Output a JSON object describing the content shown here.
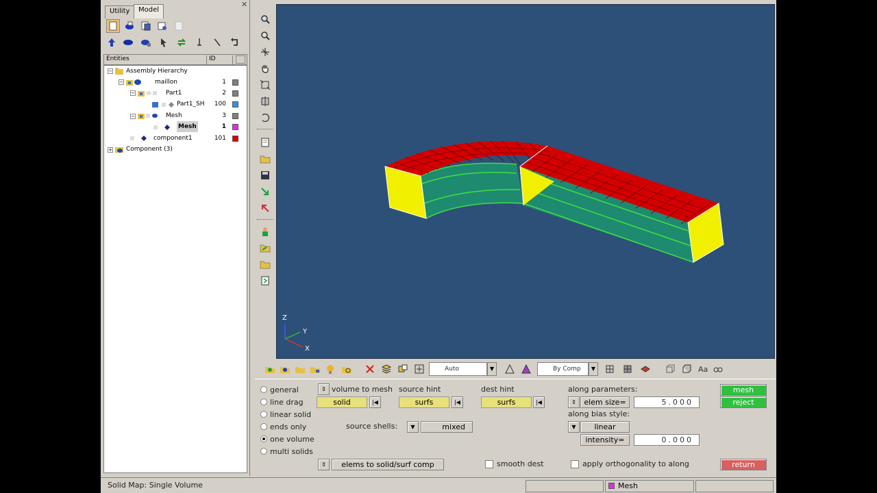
{
  "tabs": [
    {
      "label": "Utility"
    },
    {
      "label": "Model"
    }
  ],
  "entities_header": {
    "entities": "Entities",
    "id": "ID"
  },
  "tree": [
    {
      "label": "Assembly Hierarchy",
      "id": "",
      "color": ""
    },
    {
      "label": "maillon",
      "id": "1",
      "color": "#808080"
    },
    {
      "label": "Part1",
      "id": "2",
      "color": "#808080"
    },
    {
      "label": "Part1_SH",
      "id": "100",
      "color": "#3a8fe0"
    },
    {
      "label": "Mesh",
      "id": "3",
      "color": "#808080"
    },
    {
      "label": "Mesh",
      "id": "1",
      "color": "#e030e0"
    },
    {
      "label": "component1",
      "id": "101",
      "color": "#e00000"
    },
    {
      "label": "Component (3)",
      "id": "",
      "color": ""
    }
  ],
  "viewport": {
    "background": "#2d5078",
    "axis_labels": {
      "x": "X",
      "y": "Y",
      "z": "Z"
    }
  },
  "toolbar": {
    "display_mode": "Auto",
    "color_mode": "By Comp"
  },
  "panel": {
    "radios": [
      {
        "label": "general",
        "selected": false
      },
      {
        "label": "line drag",
        "selected": false
      },
      {
        "label": "linear solid",
        "selected": false
      },
      {
        "label": "ends only",
        "selected": false
      },
      {
        "label": "one volume",
        "selected": true
      },
      {
        "label": "multi solids",
        "selected": false
      }
    ],
    "volume_to_mesh": {
      "label": "volume to mesh",
      "button": "solid"
    },
    "source_hint": {
      "label": "source hint",
      "button": "surfs"
    },
    "dest_hint": {
      "label": "dest hint",
      "button": "surfs"
    },
    "source_shells": {
      "label": "source shells:",
      "value": "mixed"
    },
    "along_parameters": {
      "label": "along parameters:",
      "selector": "elem size=",
      "value": "5.000"
    },
    "along_bias_style": {
      "label": "along bias style:",
      "value": "linear"
    },
    "intensity": {
      "label": "intensity=",
      "value": "0.000"
    },
    "elems_to_comp": "elems to solid/surf comp",
    "smooth_dest": {
      "label": "smooth dest",
      "checked": false
    },
    "apply_orthogonality": {
      "label": "apply orthogonality to along",
      "checked": false
    },
    "mesh_button": "mesh",
    "reject_button": "reject",
    "return_button": "return"
  },
  "status": {
    "message": "Solid Map: Single Volume",
    "component": "Mesh",
    "component_color": "#e030e0"
  }
}
